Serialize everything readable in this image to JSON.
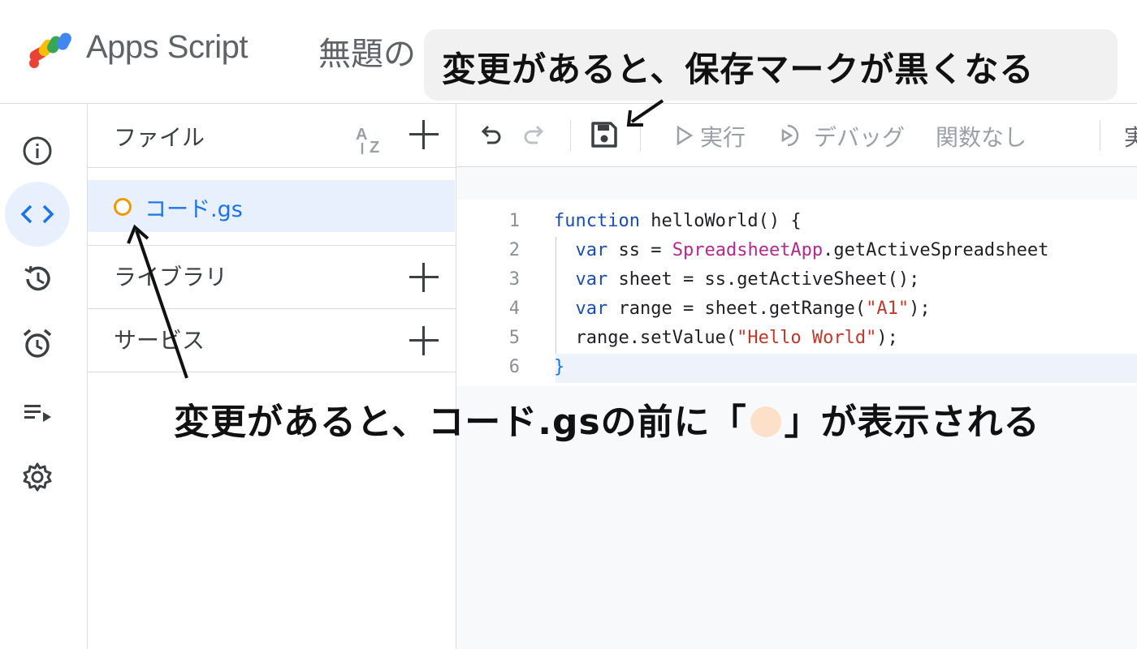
{
  "header": {
    "app_name": "Apps Script",
    "project_title": "無題の"
  },
  "callouts": {
    "save_hint": "変更があると、保存マークが黒くなる",
    "file_hint_before": "変更があると、コード.gsの前に「",
    "file_hint_after": "」が表示される"
  },
  "rail": {
    "items": [
      {
        "name": "overview",
        "icon": "info-icon"
      },
      {
        "name": "editor",
        "icon": "code-icon",
        "active": true
      },
      {
        "name": "executions",
        "icon": "history-icon"
      },
      {
        "name": "triggers",
        "icon": "alarm-icon"
      },
      {
        "name": "executions-list",
        "icon": "playlist-play-icon"
      },
      {
        "name": "settings",
        "icon": "gear-icon"
      }
    ]
  },
  "files_panel": {
    "files_title": "ファイル",
    "file_name": "コード.gs",
    "libraries_title": "ライブラリ",
    "services_title": "サービス"
  },
  "toolbar": {
    "run_label": "実行",
    "debug_label": "デバッグ",
    "function_select": "関数なし",
    "overflow_label": "実"
  },
  "editor": {
    "line_numbers": [
      "1",
      "2",
      "3",
      "4",
      "5",
      "6"
    ],
    "lines": [
      "function helloWorld() {",
      "  var ss = SpreadsheetApp.getActiveSpreadsheet",
      "  var sheet = ss.getActiveSheet();",
      "  var range = sheet.getRange(\"A1\");",
      "  range.setValue(\"Hello World\");",
      "}"
    ]
  },
  "colors": {
    "accent": "#1a73e8",
    "active_bg": "#e8f0fe",
    "modified_dot": "#f29900",
    "callout_dot": "#fde0c8"
  }
}
